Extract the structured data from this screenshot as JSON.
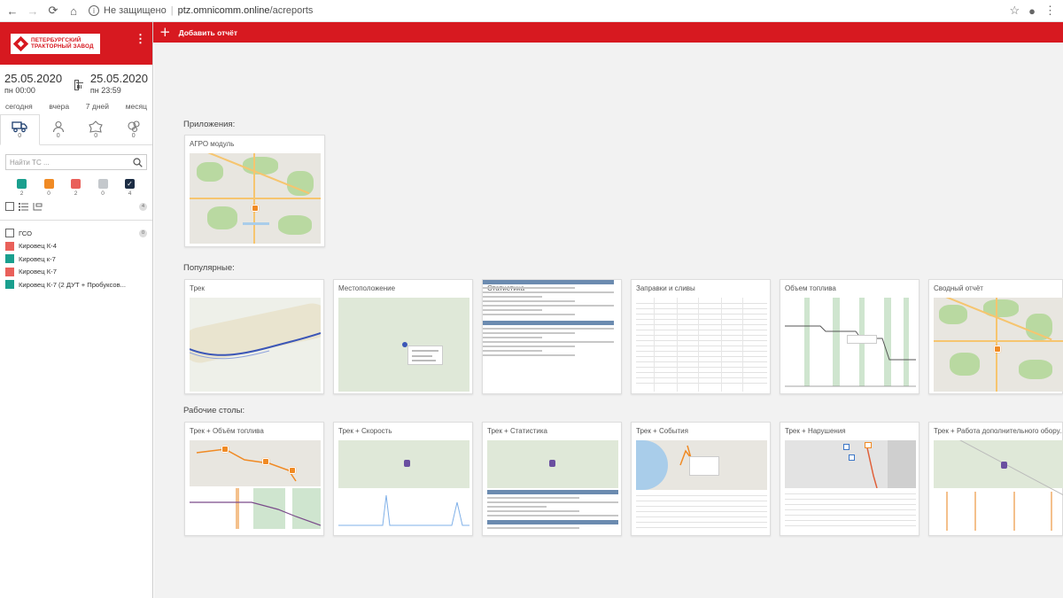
{
  "browser": {
    "security_label": "Не защищено",
    "url_host": "ptz.omnicomm.online",
    "url_path": "/acreports",
    "info_symbol": "i",
    "back_symbol": "←",
    "forward_symbol": "→",
    "reload_symbol": "⟳",
    "home_symbol": "⌂",
    "star_symbol": "☆",
    "profile_symbol": "●",
    "menu_symbol": "⋮"
  },
  "sidebar": {
    "logo_line1": "ПЕТЕРБУРГСКИЙ",
    "logo_line2": "ТРАКТОРНЫЙ ЗАВОД",
    "menu_symbol": "⋮",
    "date_from": "25.05.2020",
    "time_from": "пн 00:00",
    "date_to": "25.05.2020",
    "time_to": "пн 23:59",
    "periods": [
      "сегодня",
      "вчера",
      "7 дней",
      "месяц"
    ],
    "tabs": [
      {
        "icon": "truck-icon",
        "count": "0"
      },
      {
        "icon": "person-icon",
        "count": "0"
      },
      {
        "icon": "geofence-icon",
        "count": "0"
      },
      {
        "icon": "group-icon",
        "count": "0"
      }
    ],
    "search_placeholder": "Найти ТС ...",
    "statuses": [
      {
        "color": "#1a9f8e",
        "count": "2"
      },
      {
        "color": "#f08a24",
        "count": "0"
      },
      {
        "color": "#e9605a",
        "count": "2"
      },
      {
        "color": "#c4c8cc",
        "count": "0"
      },
      {
        "color": "#1c2d44",
        "count": "4",
        "checked": true
      }
    ],
    "check_symbol": "✓",
    "total_badge": "4",
    "group": {
      "label": "ГСО",
      "badge": "0"
    },
    "vehicles": [
      {
        "name": "Кировец К-4",
        "color": "#e9605a"
      },
      {
        "name": "Кировец к-7",
        "color": "#1a9f8e"
      },
      {
        "name": "Кировец К-7",
        "color": "#e9605a"
      },
      {
        "name": "Кировец К-7 (2 ДУТ + Пробуксов...",
        "color": "#1a9f8e"
      }
    ]
  },
  "toolbar": {
    "plus_symbol": "+",
    "add_report_label": "Добавить отчёт"
  },
  "sections": {
    "apps_title": "Приложения:",
    "popular_title": "Популярные:",
    "desktops_title": "Рабочие столы:"
  },
  "apps": [
    {
      "title": "АГРО модуль"
    }
  ],
  "popular": [
    {
      "title": "Трек"
    },
    {
      "title": "Местоположение"
    },
    {
      "title": "Статистика"
    },
    {
      "title": "Заправки и сливы"
    },
    {
      "title": "Объем топлива"
    },
    {
      "title": "Сводный отчёт"
    }
  ],
  "desktops": [
    {
      "title": "Трек + Объём топлива"
    },
    {
      "title": "Трек + Скорость"
    },
    {
      "title": "Трек + Статистика"
    },
    {
      "title": "Трек + События"
    },
    {
      "title": "Трек + Нарушения"
    },
    {
      "title": "Трек + Работа дополнительного обору..."
    }
  ],
  "colors": {
    "brand_red": "#d71920",
    "teal": "#1a9f8e",
    "orange": "#f08a24",
    "salmon": "#e9605a",
    "grey": "#c4c8cc",
    "navy": "#1c2d44"
  }
}
